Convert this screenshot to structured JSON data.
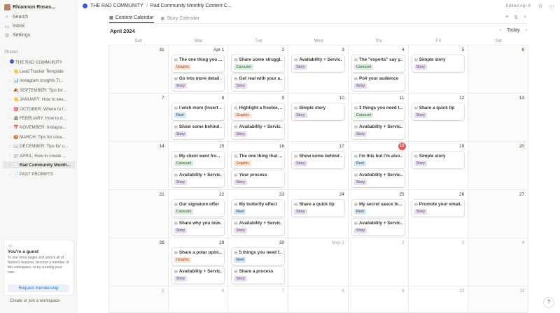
{
  "sidebar": {
    "workspace_name": "Rhiannon Rosas...",
    "nav": [
      {
        "label": "Search",
        "icon": "search-icon"
      },
      {
        "label": "Inbox",
        "icon": "inbox-icon"
      },
      {
        "label": "Settings",
        "icon": "gear-icon"
      }
    ],
    "section_label": "Shared",
    "tree": [
      {
        "label": "THE RAD COMMUNITY",
        "emoji": "●",
        "level": 0,
        "active": false
      },
      {
        "label": "Lead Tracker Template",
        "emoji": "👋",
        "level": 1,
        "active": false
      },
      {
        "label": "Instagram Insights Tr...",
        "emoji": "📊",
        "level": 1,
        "active": false
      },
      {
        "label": "SEPTEMBER: Tips for ...",
        "emoji": "🍂",
        "level": 1,
        "active": false
      },
      {
        "label": "JANUARY: How to kee...",
        "emoji": "👋",
        "level": 1,
        "active": false
      },
      {
        "label": "OCTOBER: Where to f...",
        "emoji": "🎯",
        "level": 1,
        "active": false
      },
      {
        "label": "FEBRUARY: How to d...",
        "emoji": "🏛",
        "level": 1,
        "active": false
      },
      {
        "label": "NOVEMBER: Instagra...",
        "emoji": "📅",
        "level": 1,
        "active": false
      },
      {
        "label": "MARCH: Tips for crea...",
        "emoji": "🍪",
        "level": 1,
        "active": false
      },
      {
        "label": "DECEMBER: Tips for u...",
        "emoji": "📖",
        "level": 1,
        "active": false
      },
      {
        "label": "APRIL: How to create ...",
        "emoji": "📰",
        "level": 1,
        "active": false
      },
      {
        "label": "Rad Community Month...",
        "emoji": "📄",
        "level": 1,
        "active": true
      },
      {
        "label": "PAST PROMPTS",
        "emoji": "📄",
        "level": 1,
        "active": false
      }
    ],
    "guest": {
      "title": "You're a guest",
      "text": "To see more pages and unlock all of Notion's features, become a member of this workspace, or try creating your own.",
      "button": "Request membership",
      "create_link": "Create or join a workspace"
    }
  },
  "topbar": {
    "crumb1": "THE RAD COMMUNITY",
    "crumb_sep": "/",
    "crumb2": "Rad Community Monthly Content C...",
    "edited": "Edited Apr 8"
  },
  "tabs": [
    {
      "label": "Content Calendar",
      "active": true
    },
    {
      "label": "Story Calendar",
      "active": false
    }
  ],
  "calendar": {
    "month_label": "April 2024",
    "today_label": "Today",
    "weekdays": [
      "Sun",
      "Mon",
      "Tue",
      "Wed",
      "Thu",
      "Fri",
      "Sat"
    ],
    "weeks": [
      [
        {
          "num": "31",
          "muted": false,
          "cards": []
        },
        {
          "num": "Apr 1",
          "muted": false,
          "cards": [
            {
              "title": "The one thing you ...",
              "tag": "Graphic"
            },
            {
              "title": "Go into more detail ...",
              "tag": "Story"
            }
          ]
        },
        {
          "num": "2",
          "muted": false,
          "cards": [
            {
              "title": "Share some struggl...",
              "tag": "Carousel"
            },
            {
              "title": "Get real with your a...",
              "tag": "Story"
            }
          ]
        },
        {
          "num": "3",
          "muted": false,
          "cards": [
            {
              "title": "Availability + Servic...",
              "tag": "Story"
            }
          ]
        },
        {
          "num": "4",
          "muted": false,
          "cards": [
            {
              "title": "The \"experts\" say y...",
              "tag": "Carousel"
            },
            {
              "title": "Poll your audience",
              "tag": "Story"
            }
          ]
        },
        {
          "num": "5",
          "muted": false,
          "cards": [
            {
              "title": "Simple story",
              "tag": "Story"
            }
          ]
        },
        {
          "num": "6",
          "muted": false,
          "cards": []
        }
      ],
      [
        {
          "num": "7",
          "muted": false,
          "cards": []
        },
        {
          "num": "8",
          "muted": false,
          "cards": [
            {
              "title": "I wish more (insert ...",
              "tag": "Reel"
            },
            {
              "title": "Show some behind ...",
              "tag": "Story"
            }
          ]
        },
        {
          "num": "9",
          "muted": false,
          "cards": [
            {
              "title": "Highlight a freebie, ...",
              "tag": "Graphic"
            },
            {
              "title": "Availability + Servic...",
              "tag": "Story"
            }
          ]
        },
        {
          "num": "10",
          "muted": false,
          "cards": [
            {
              "title": "Simple story",
              "tag": "Story"
            }
          ]
        },
        {
          "num": "11",
          "muted": false,
          "cards": [
            {
              "title": "3 things you need t...",
              "tag": "Carousel"
            },
            {
              "title": "Availability + Servic...",
              "tag": "Story"
            }
          ]
        },
        {
          "num": "12",
          "muted": false,
          "cards": [
            {
              "title": "Share a quick tip",
              "tag": "Story"
            }
          ]
        },
        {
          "num": "13",
          "muted": false,
          "cards": []
        }
      ],
      [
        {
          "num": "14",
          "muted": false,
          "cards": []
        },
        {
          "num": "15",
          "muted": false,
          "cards": [
            {
              "title": "My client went fro...",
              "tag": "Carousel"
            },
            {
              "title": "Availability + Servic...",
              "tag": "Story"
            }
          ]
        },
        {
          "num": "16",
          "muted": false,
          "cards": [
            {
              "title": "The one thing that ...",
              "tag": "Graphic"
            },
            {
              "title": "Your process",
              "tag": "Story"
            }
          ]
        },
        {
          "num": "17",
          "muted": false,
          "cards": [
            {
              "title": "Show some behind ...",
              "tag": "Story"
            }
          ]
        },
        {
          "num": "18",
          "muted": false,
          "today": true,
          "cards": [
            {
              "title": "I'm this but I'm also...",
              "tag": "Reel"
            },
            {
              "title": "Availability + Servic...",
              "tag": "Story"
            }
          ]
        },
        {
          "num": "19",
          "muted": false,
          "cards": [
            {
              "title": "Simple story",
              "tag": "Story"
            }
          ]
        },
        {
          "num": "20",
          "muted": false,
          "cards": []
        }
      ],
      [
        {
          "num": "21",
          "muted": false,
          "cards": []
        },
        {
          "num": "22",
          "muted": false,
          "cards": [
            {
              "title": "Our signature offer",
              "tag": "Carousel"
            },
            {
              "title": "Share why you love...",
              "tag": "Story"
            }
          ]
        },
        {
          "num": "23",
          "muted": false,
          "cards": [
            {
              "title": "My butterfly effect",
              "tag": "Reel"
            },
            {
              "title": "Availability + Servic...",
              "tag": "Story"
            }
          ]
        },
        {
          "num": "24",
          "muted": false,
          "cards": [
            {
              "title": "Share a quick tip",
              "tag": "Story"
            }
          ]
        },
        {
          "num": "25",
          "muted": false,
          "cards": [
            {
              "title": "My secret sauce fo...",
              "tag": "Reel"
            },
            {
              "title": "Availability + Servic...",
              "tag": "Story"
            }
          ]
        },
        {
          "num": "26",
          "muted": false,
          "cards": [
            {
              "title": "Promote your email...",
              "tag": "Story"
            }
          ]
        },
        {
          "num": "27",
          "muted": false,
          "cards": []
        }
      ],
      [
        {
          "num": "28",
          "muted": false,
          "cards": []
        },
        {
          "num": "29",
          "muted": false,
          "cards": [
            {
              "title": "Share a polar opini...",
              "tag": "Graphic"
            },
            {
              "title": "Availability + Servic...",
              "tag": "Story"
            }
          ]
        },
        {
          "num": "30",
          "muted": false,
          "cards": [
            {
              "title": "5 things you need f...",
              "tag": "Reel"
            },
            {
              "title": "Share a process",
              "tag": "Story"
            }
          ]
        },
        {
          "num": "May 1",
          "muted": true,
          "cards": []
        },
        {
          "num": "2",
          "muted": true,
          "cards": []
        },
        {
          "num": "3",
          "muted": true,
          "cards": []
        },
        {
          "num": "4",
          "muted": true,
          "cards": []
        }
      ],
      [
        {
          "num": "5",
          "muted": true,
          "cards": []
        },
        {
          "num": "6",
          "muted": true,
          "cards": []
        },
        {
          "num": "7",
          "muted": true,
          "cards": []
        },
        {
          "num": "8",
          "muted": true,
          "cards": []
        },
        {
          "num": "9",
          "muted": true,
          "cards": []
        },
        {
          "num": "10",
          "muted": true,
          "cards": []
        },
        {
          "num": "11",
          "muted": true,
          "cards": []
        }
      ]
    ]
  },
  "tag_colors": {
    "Graphic": {
      "bg": "#fae3d4",
      "fg": "#8a4a1c"
    },
    "Story": {
      "bg": "#e8deee",
      "fg": "#5a3a78"
    },
    "Carousel": {
      "bg": "#dbeddb",
      "fg": "#2b593f"
    },
    "Reel": {
      "bg": "#d3e5ef",
      "fg": "#28456c"
    }
  },
  "help_label": "?"
}
